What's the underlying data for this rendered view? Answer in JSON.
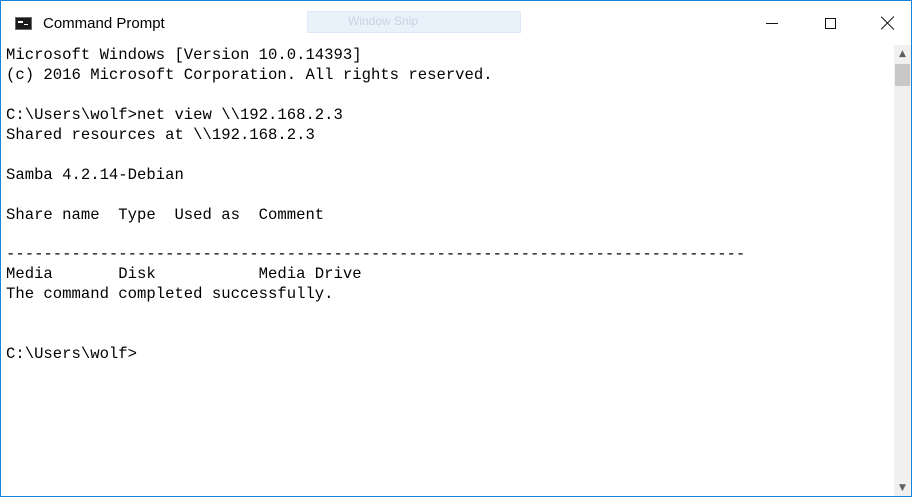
{
  "window": {
    "title": "Command Prompt"
  },
  "snip_tab": {
    "label": "Window Snip"
  },
  "controls": {
    "minimize_icon": "minimize-icon",
    "maximize_icon": "maximize-icon",
    "close_icon": "close-icon"
  },
  "console": {
    "lines": [
      "Microsoft Windows [Version 10.0.14393]",
      "(c) 2016 Microsoft Corporation. All rights reserved.",
      "",
      "C:\\Users\\wolf>net view \\\\192.168.2.3",
      "Shared resources at \\\\192.168.2.3",
      "",
      "Samba 4.2.14-Debian",
      "",
      "Share name  Type  Used as  Comment",
      "",
      "-------------------------------------------------------------------------------",
      "Media       Disk           Media Drive",
      "The command completed successfully.",
      "",
      "",
      "C:\\Users\\wolf>"
    ]
  },
  "scrollbar": {
    "up_arrow": "▲",
    "down_arrow": "▼"
  },
  "colors": {
    "accent_border": "#1883d7",
    "console_bg": "#ffffff",
    "console_text": "#000000"
  }
}
